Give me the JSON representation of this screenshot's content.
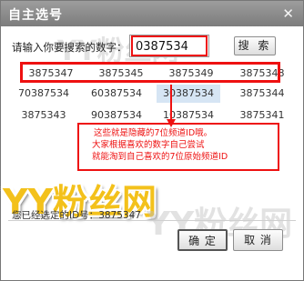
{
  "dialog": {
    "title": "自主选号",
    "close_icon": "close-icon"
  },
  "search": {
    "prompt": "请输入你要搜索的数字：",
    "value": "0387534",
    "button_label": "搜 索"
  },
  "results": {
    "rows": [
      [
        "3875347",
        "3875345",
        "3875349",
        "3875348"
      ],
      [
        "70387534",
        "60387534",
        "30387534",
        "3875344"
      ],
      [
        "3875343",
        "90387534",
        "10387534",
        "3875341"
      ]
    ],
    "selected_row": 1,
    "selected_col": 2
  },
  "annotation": {
    "lines": [
      "这些就是隐藏的7位频道ID哦。",
      "大家根据喜欢的数字自己尝试",
      "就能淘到自己喜欢的7位原始频道ID"
    ],
    "color": "#e11111"
  },
  "watermark": {
    "text": "YY粉丝网"
  },
  "footer": {
    "selected_label": "您已经选定的ID号：",
    "selected_value": "3875347",
    "ok_label": "确 定",
    "cancel_label": "取 消"
  }
}
